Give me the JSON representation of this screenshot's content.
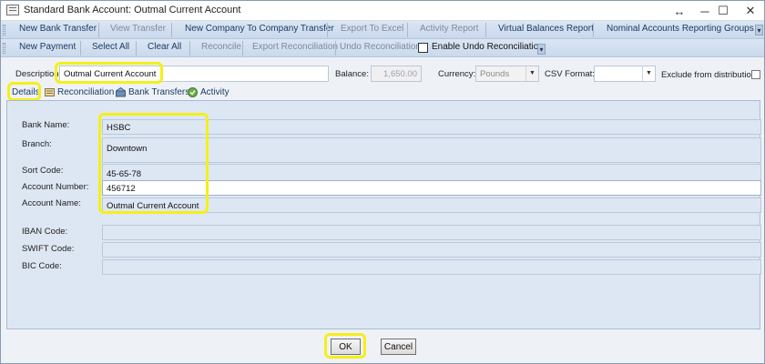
{
  "window": {
    "title": "Standard Bank Account: Outmal Current Account",
    "controls": {
      "resize": "↔",
      "minimize": "─",
      "maximize": "☐",
      "close": "✕"
    }
  },
  "toolbar1": {
    "items": [
      "New Bank Transfer",
      "View Transfer",
      "New Company To Company Transfer",
      "Export To Excel",
      "Activity Report",
      "Virtual Balances Report",
      "Nominal Accounts Reporting Groups"
    ]
  },
  "toolbar2": {
    "items": [
      "New Payment",
      "Select All",
      "Clear All",
      "Reconcile",
      "Export Reconciliation",
      "Undo Reconciliation"
    ],
    "checkbox_label": "Enable Undo Reconciliation"
  },
  "header_fields": {
    "description_label": "Description:",
    "description_value": "Outmal Current Account",
    "balance_label": "Balance:",
    "balance_value": "1,650.00",
    "currency_label": "Currency:",
    "currency_value": "Pounds",
    "csv_label": "CSV Format:",
    "csv_value": "",
    "exclude_label": "Exclude from distribution"
  },
  "tabs": [
    {
      "label": "Details",
      "icon": "details-icon"
    },
    {
      "label": "Reconciliation",
      "icon": "reconciliation-icon"
    },
    {
      "label": "Bank Transfers",
      "icon": "bank-transfers-icon"
    },
    {
      "label": "Activity",
      "icon": "activity-icon"
    }
  ],
  "details": {
    "bank_name_label": "Bank Name:",
    "bank_name": "HSBC",
    "branch_label": "Branch:",
    "branch": "Downtown",
    "sort_code_label": "Sort Code:",
    "sort_code": "45-65-78",
    "account_number_label": "Account Number:",
    "account_number": "456712",
    "account_name_label": "Account Name:",
    "account_name": "Outmal Current Account",
    "iban_label": "IBAN Code:",
    "iban": "",
    "swift_label": "SWIFT Code:",
    "swift": "",
    "bic_label": "BIC Code:",
    "bic": ""
  },
  "buttons": {
    "ok": "OK",
    "cancel": "Cancel"
  },
  "colors": {
    "highlight": "#f5ef1a",
    "panel": "#dde7f3",
    "toolbar": "#c9d9ec"
  }
}
